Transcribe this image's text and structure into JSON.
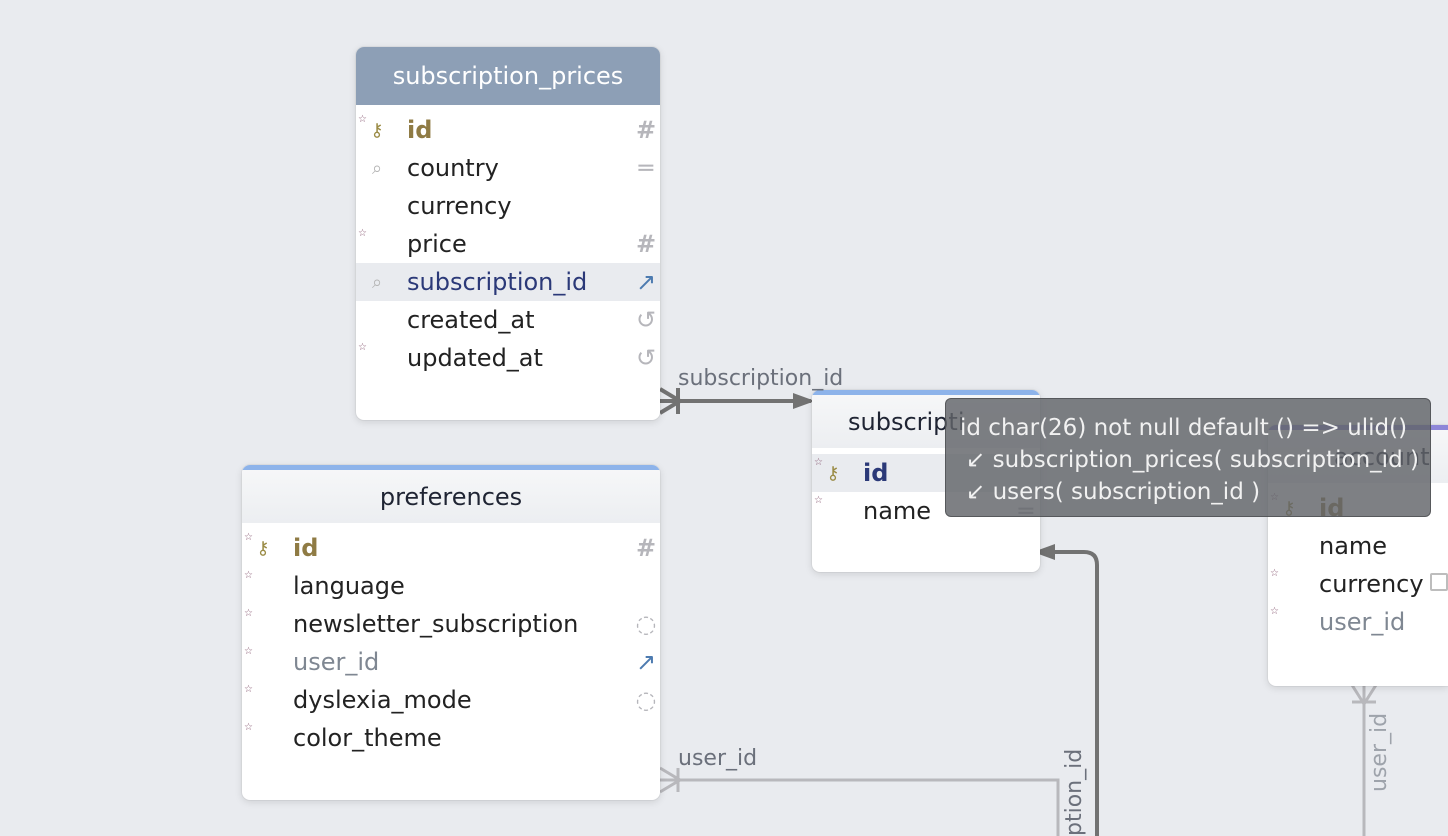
{
  "tables": {
    "subscription_prices": {
      "title": "subscription_prices",
      "rows": [
        {
          "name": "id",
          "kind": "pk",
          "type_icon": "hash",
          "left_icon": "key-icon"
        },
        {
          "name": "country",
          "kind": "normal",
          "type_icon": "text",
          "left_icon": "search-icon"
        },
        {
          "name": "currency",
          "kind": "normal",
          "type_icon": "none",
          "left_icon": "none"
        },
        {
          "name": "price",
          "kind": "normal",
          "type_icon": "hash",
          "left_icon": "none"
        },
        {
          "name": "subscription_id",
          "kind": "fk",
          "type_icon": "arrow",
          "left_icon": "search-icon"
        },
        {
          "name": "created_at",
          "kind": "normal",
          "type_icon": "history",
          "left_icon": "none"
        },
        {
          "name": "updated_at",
          "kind": "normal",
          "type_icon": "history",
          "left_icon": "none"
        }
      ]
    },
    "preferences": {
      "title": "preferences",
      "rows": [
        {
          "name": "id",
          "kind": "pk",
          "type_icon": "hash",
          "left_icon": "key-icon"
        },
        {
          "name": "language",
          "kind": "normal",
          "type_icon": "none",
          "left_icon": "none"
        },
        {
          "name": "newsletter_subscription",
          "kind": "normal",
          "type_icon": "check",
          "left_icon": "none"
        },
        {
          "name": "user_id",
          "kind": "muted",
          "type_icon": "arrow",
          "left_icon": "none"
        },
        {
          "name": "dyslexia_mode",
          "kind": "normal",
          "type_icon": "check",
          "left_icon": "none"
        },
        {
          "name": "color_theme",
          "kind": "normal",
          "type_icon": "none",
          "left_icon": "none"
        }
      ]
    },
    "subscriptions": {
      "title": "subscriptions",
      "visible_title": "subscripti",
      "rows": [
        {
          "name": "id",
          "kind": "fk",
          "type_icon": "none",
          "left_icon": "key-icon"
        },
        {
          "name": "name",
          "kind": "normal",
          "type_icon": "text",
          "left_icon": "none"
        }
      ]
    },
    "account": {
      "title": "account",
      "visible_title": "account",
      "rows": [
        {
          "name": "id",
          "kind": "pk",
          "type_icon": "none",
          "left_icon": "key-icon"
        },
        {
          "name": "name",
          "kind": "normal",
          "type_icon": "none",
          "left_icon": "none"
        },
        {
          "name": "currency",
          "kind": "normal",
          "type_icon": "comment",
          "left_icon": "none"
        },
        {
          "name": "user_id",
          "kind": "muted",
          "type_icon": "none",
          "left_icon": "none"
        }
      ]
    }
  },
  "labels": {
    "sp_to_sub": "subscription_id",
    "pref_user": "user_id",
    "sub_vertical": "ption_id",
    "account_user": "user_id"
  },
  "tooltip": {
    "line1": "id char(26) not null default () => ulid()",
    "line2": "↙ subscription_prices( subscription_id )",
    "line3": "↙ users( subscription_id )"
  },
  "colors": {
    "background": "#e9ebef",
    "selected_header": "#8d9fb6",
    "blue_accent": "#8db3ea",
    "purple_accent": "#8d86d8"
  }
}
